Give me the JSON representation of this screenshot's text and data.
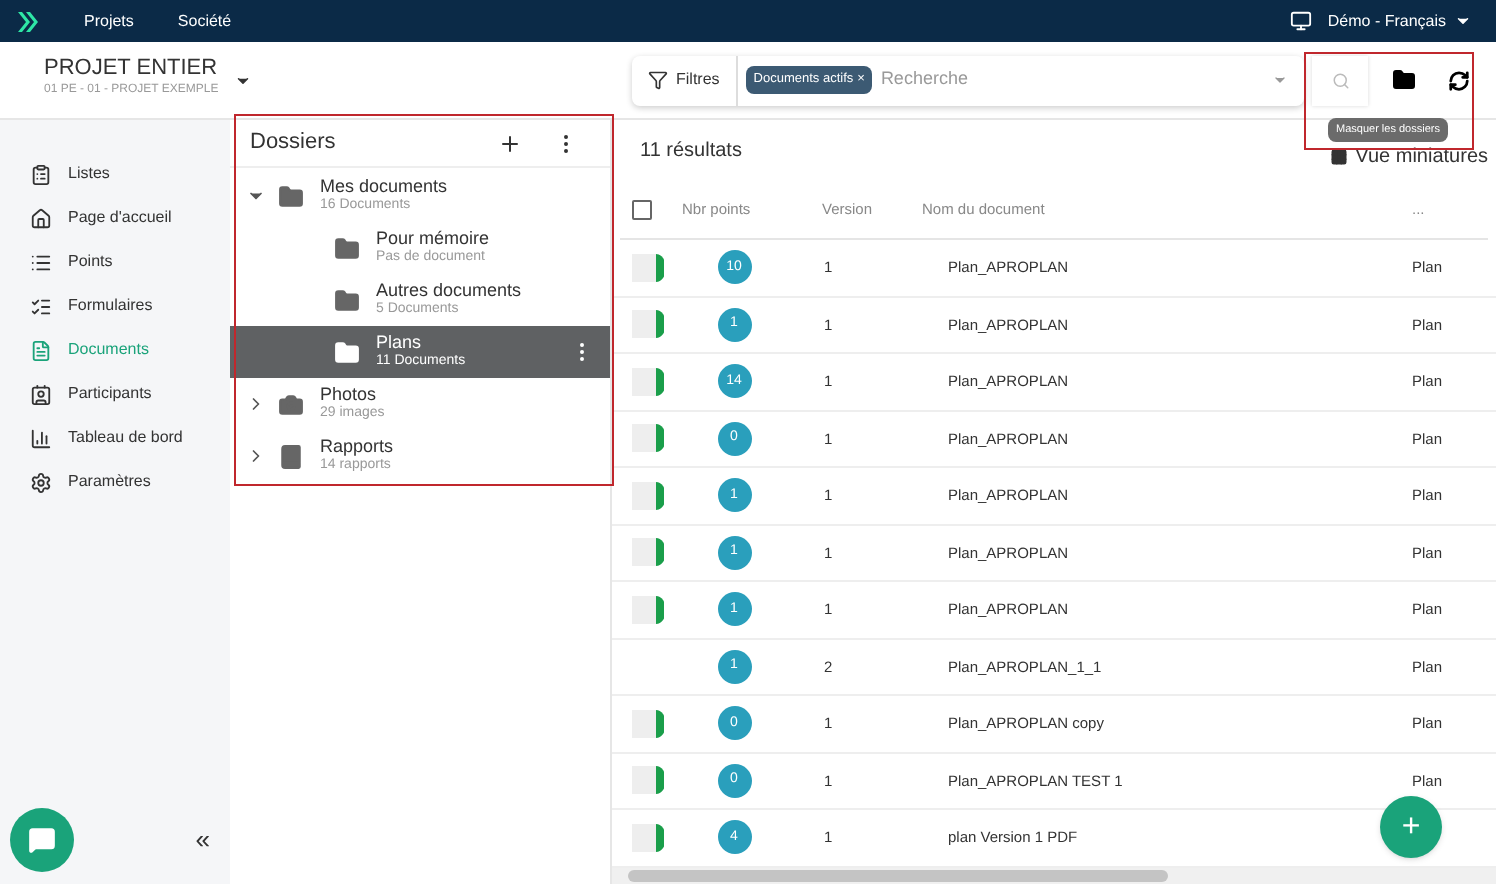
{
  "topbar": {
    "menu": [
      "Projets",
      "Société"
    ],
    "account": "Démo - Français"
  },
  "project": {
    "title": "PROJET ENTIER",
    "subtitle": "01 PE - 01 - PROJET EXEMPLE"
  },
  "search": {
    "filter_button": "Filtres",
    "chip": "Documents actifs",
    "chip_remove": "×",
    "placeholder": "Recherche"
  },
  "tooltip": "Masquer les dossiers",
  "sidebar": {
    "items": [
      {
        "label": "Listes",
        "selected": false
      },
      {
        "label": "Page d'accueil",
        "selected": false
      },
      {
        "label": "Points",
        "selected": false
      },
      {
        "label": "Formulaires",
        "selected": false
      },
      {
        "label": "Documents",
        "selected": true
      },
      {
        "label": "Participants",
        "selected": false
      },
      {
        "label": "Tableau de bord",
        "selected": false
      },
      {
        "label": "Paramètres",
        "selected": false
      }
    ]
  },
  "folders": {
    "title": "Dossiers",
    "items": [
      {
        "name": "Mes documents",
        "count": "16 Documents",
        "kind": "folder",
        "expanded": true,
        "selected": false,
        "children": [
          {
            "name": "Pour mémoire",
            "count": "Pas de document",
            "kind": "folder",
            "selected": false
          },
          {
            "name": "Autres documents",
            "count": "5 Documents",
            "kind": "folder",
            "selected": false
          },
          {
            "name": "Plans",
            "count": "11 Documents",
            "kind": "folder",
            "selected": true
          }
        ]
      },
      {
        "name": "Photos",
        "count": "29 images",
        "kind": "photos",
        "expanded": false,
        "selected": false
      },
      {
        "name": "Rapports",
        "count": "14 rapports",
        "kind": "reports",
        "expanded": false,
        "selected": false
      }
    ]
  },
  "results": {
    "count": "11 résultats",
    "view_toggle": "Vue miniatures"
  },
  "table": {
    "select_all": {
      "checked": false
    },
    "columns": [
      "Nbr points",
      "Version",
      "Nom du document",
      "..."
    ],
    "rows": [
      {
        "thumbnail": true,
        "points": "10",
        "version": "1",
        "name": "Plan_APROPLAN",
        "type": "Plan"
      },
      {
        "thumbnail": true,
        "points": "1",
        "version": "1",
        "name": "Plan_APROPLAN",
        "type": "Plan"
      },
      {
        "thumbnail": true,
        "points": "14",
        "version": "1",
        "name": "Plan_APROPLAN",
        "type": "Plan"
      },
      {
        "thumbnail": true,
        "points": "0",
        "version": "1",
        "name": "Plan_APROPLAN",
        "type": "Plan"
      },
      {
        "thumbnail": true,
        "points": "1",
        "version": "1",
        "name": "Plan_APROPLAN",
        "type": "Plan"
      },
      {
        "thumbnail": true,
        "points": "1",
        "version": "1",
        "name": "Plan_APROPLAN",
        "type": "Plan"
      },
      {
        "thumbnail": true,
        "points": "1",
        "version": "1",
        "name": "Plan_APROPLAN",
        "type": "Plan"
      },
      {
        "thumbnail": false,
        "points": "1",
        "version": "2",
        "name": "Plan_APROPLAN_1_1",
        "type": "Plan"
      },
      {
        "thumbnail": true,
        "points": "0",
        "version": "1",
        "name": "Plan_APROPLAN copy",
        "type": "Plan"
      },
      {
        "thumbnail": true,
        "points": "0",
        "version": "1",
        "name": "Plan_APROPLAN TEST 1",
        "type": "Plan"
      },
      {
        "thumbnail": true,
        "points": "4",
        "version": "1",
        "name": "plan Version 1 PDF"
      }
    ]
  },
  "collapse": "«",
  "fab": "+"
}
